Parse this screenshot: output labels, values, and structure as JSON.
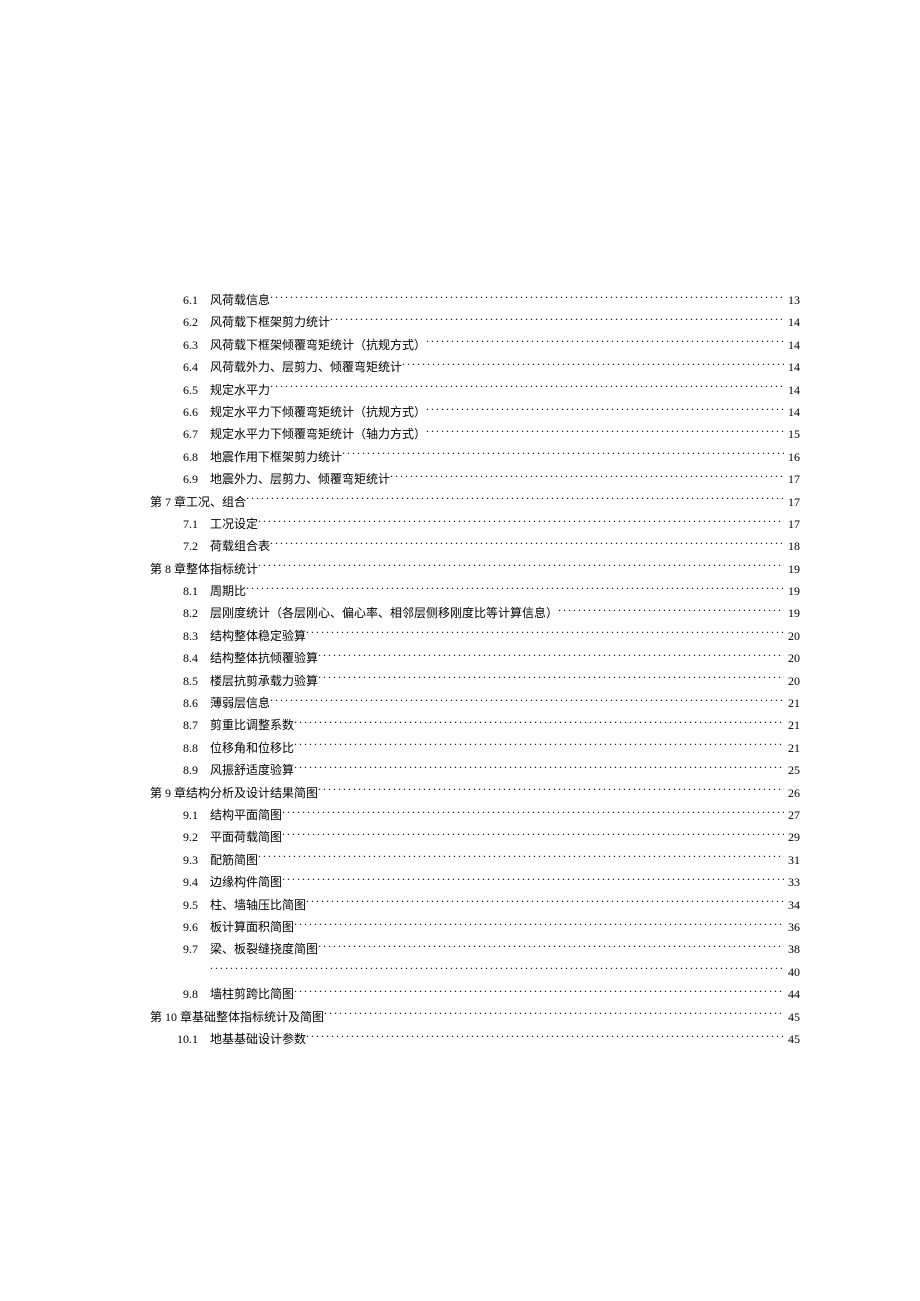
{
  "toc": [
    {
      "type": "sub",
      "num": "6.1",
      "title": "风荷载信息",
      "page": "13"
    },
    {
      "type": "sub",
      "num": "6.2",
      "title": "风荷载下框架剪力统计",
      "page": "14"
    },
    {
      "type": "sub",
      "num": "6.3",
      "title": "风荷载下框架倾覆弯矩统计（抗规方式）",
      "page": "14"
    },
    {
      "type": "sub",
      "num": "6.4",
      "title": "风荷载外力、层剪力、倾覆弯矩统计",
      "page": "14"
    },
    {
      "type": "sub",
      "num": "6.5",
      "title": "规定水平力",
      "page": "14"
    },
    {
      "type": "sub",
      "num": "6.6",
      "title": "规定水平力下倾覆弯矩统计（抗规方式）",
      "page": "14"
    },
    {
      "type": "sub",
      "num": "6.7",
      "title": "规定水平力下倾覆弯矩统计（轴力方式）",
      "page": "15"
    },
    {
      "type": "sub",
      "num": "6.8",
      "title": "地震作用下框架剪力统计",
      "page": "16"
    },
    {
      "type": "sub",
      "num": "6.9",
      "title": "地震外力、层剪力、倾覆弯矩统计",
      "page": "17"
    },
    {
      "type": "chapter",
      "num": "第 7 章",
      "title": "工况、组合",
      "page": "17"
    },
    {
      "type": "sub",
      "num": "7.1",
      "title": "工况设定",
      "page": "17"
    },
    {
      "type": "sub",
      "num": "7.2",
      "title": "荷载组合表",
      "page": "18"
    },
    {
      "type": "chapter",
      "num": "第 8 章",
      "title": "整体指标统计",
      "page": "19"
    },
    {
      "type": "sub",
      "num": "8.1",
      "title": "周期比",
      "page": "19"
    },
    {
      "type": "sub",
      "num": "8.2",
      "title": "层刚度统计（各层刚心、偏心率、相邻层侧移刚度比等计算信息）",
      "page": "19"
    },
    {
      "type": "sub",
      "num": "8.3",
      "title": "结构整体稳定验算",
      "page": "20"
    },
    {
      "type": "sub",
      "num": "8.4",
      "title": "结构整体抗倾覆验算",
      "page": "20"
    },
    {
      "type": "sub",
      "num": "8.5",
      "title": "楼层抗剪承载力验算",
      "page": "20"
    },
    {
      "type": "sub",
      "num": "8.6",
      "title": "薄弱层信息",
      "page": "21"
    },
    {
      "type": "sub",
      "num": "8.7",
      "title": "剪重比调整系数",
      "page": "21"
    },
    {
      "type": "sub",
      "num": "8.8",
      "title": "位移角和位移比",
      "page": "21"
    },
    {
      "type": "sub",
      "num": "8.9",
      "title": "风振舒适度验算",
      "page": "25"
    },
    {
      "type": "chapter",
      "num": "第 9 章",
      "title": "结构分析及设计结果简图",
      "page": "26"
    },
    {
      "type": "sub",
      "num": "9.1",
      "title": "结构平面简图",
      "page": "27"
    },
    {
      "type": "sub",
      "num": "9.2",
      "title": "平面荷载简图",
      "page": "29"
    },
    {
      "type": "sub",
      "num": "9.3",
      "title": "配筋简图",
      "page": "31"
    },
    {
      "type": "sub",
      "num": "9.4",
      "title": "边缘构件简图",
      "page": "33"
    },
    {
      "type": "sub",
      "num": "9.5",
      "title": "柱、墙轴压比简图",
      "page": "34"
    },
    {
      "type": "sub",
      "num": "9.6",
      "title": "板计算面积简图",
      "page": "36"
    },
    {
      "type": "sub",
      "num": "9.7",
      "title": "梁、板裂缝挠度简图",
      "page": "38"
    },
    {
      "type": "blank",
      "num": "",
      "title": "",
      "page": "40"
    },
    {
      "type": "sub",
      "num": "9.8",
      "title": "墙柱剪跨比简图",
      "page": "44"
    },
    {
      "type": "chapter",
      "num": "第 10 章",
      "title": "基础整体指标统计及简图",
      "page": "45"
    },
    {
      "type": "sub",
      "num": "10.1",
      "title": "地基基础设计参数",
      "page": "45"
    }
  ]
}
